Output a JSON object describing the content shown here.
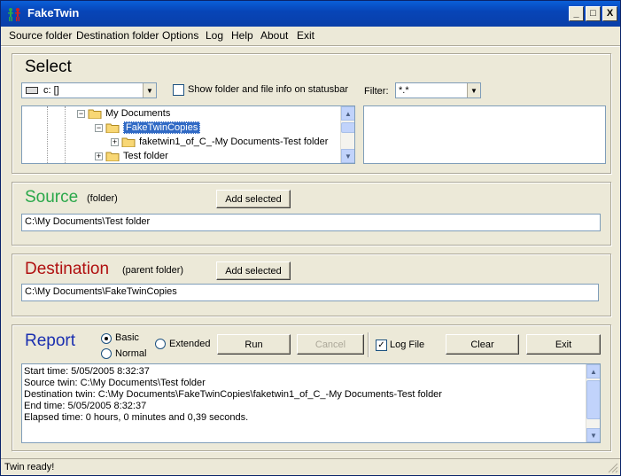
{
  "window": {
    "title": "FakeTwin",
    "minimize": "_",
    "maximize": "□",
    "close": "X"
  },
  "menu": {
    "items": [
      {
        "label": "Source folder"
      },
      {
        "label": "Destination folder"
      },
      {
        "label": "Options"
      },
      {
        "label": "Log"
      },
      {
        "label": "Help"
      },
      {
        "label": "About"
      },
      {
        "label": "Exit"
      }
    ]
  },
  "select": {
    "title": "Select",
    "drive": "c: []",
    "show_info_label": "Show folder and file info on statusbar",
    "show_info_checked": false,
    "filter_label": "Filter:",
    "filter_value": "*.*",
    "tree": [
      {
        "label": "My Documents",
        "expander": "−"
      },
      {
        "label": "FakeTwinCopies",
        "expander": "−",
        "selected": true
      },
      {
        "label": "faketwin1_of_C_-My Documents-Test folder",
        "expander": "+"
      },
      {
        "label": "Test folder",
        "expander": "+"
      }
    ]
  },
  "source": {
    "title": "Source",
    "subtitle": "(folder)",
    "add_label": "Add selected",
    "path": "C:\\My Documents\\Test folder",
    "color": "#2aa84a"
  },
  "destination": {
    "title": "Destination",
    "subtitle": "(parent folder)",
    "add_label": "Add selected",
    "path": "C:\\My Documents\\FakeTwinCopies",
    "color": "#b01010"
  },
  "report": {
    "title": "Report",
    "color": "#1a2fb0",
    "radio_basic": "Basic",
    "radio_normal": "Normal",
    "radio_extended": "Extended",
    "selected": "Basic",
    "run": "Run",
    "cancel": "Cancel",
    "logfile_label": "Log File",
    "logfile_checked": true,
    "clear": "Clear",
    "exit": "Exit",
    "log_lines": [
      "Start time: 5/05/2005 8:32:37",
      "Source twin: C:\\My Documents\\Test folder",
      "Destination twin: C:\\My Documents\\FakeTwinCopies\\faketwin1_of_C_-My Documents-Test folder",
      "End time: 5/05/2005 8:32:37",
      "Elapsed time: 0 hours, 0 minutes and 0,39 seconds."
    ]
  },
  "status": {
    "text": "Twin ready!"
  }
}
